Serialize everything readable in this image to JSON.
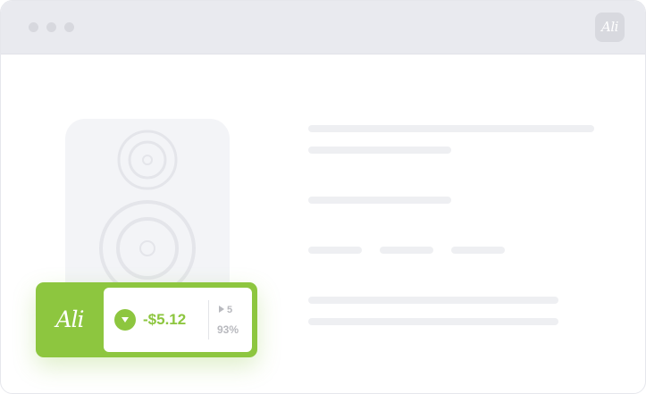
{
  "browser": {
    "extension_badge": "Ali"
  },
  "product": {
    "image_icon": "speaker-icon"
  },
  "widget": {
    "logo": "Ali",
    "trend_icon": "arrow-down-icon",
    "price_change": "-$5.12",
    "rank_icon": "play-icon",
    "rank": "5",
    "percent": "93%"
  },
  "colors": {
    "accent": "#8dc63f",
    "titlebar": "#e9eaef",
    "skeleton": "#eeeff2",
    "muted_text": "#b8b9be"
  }
}
